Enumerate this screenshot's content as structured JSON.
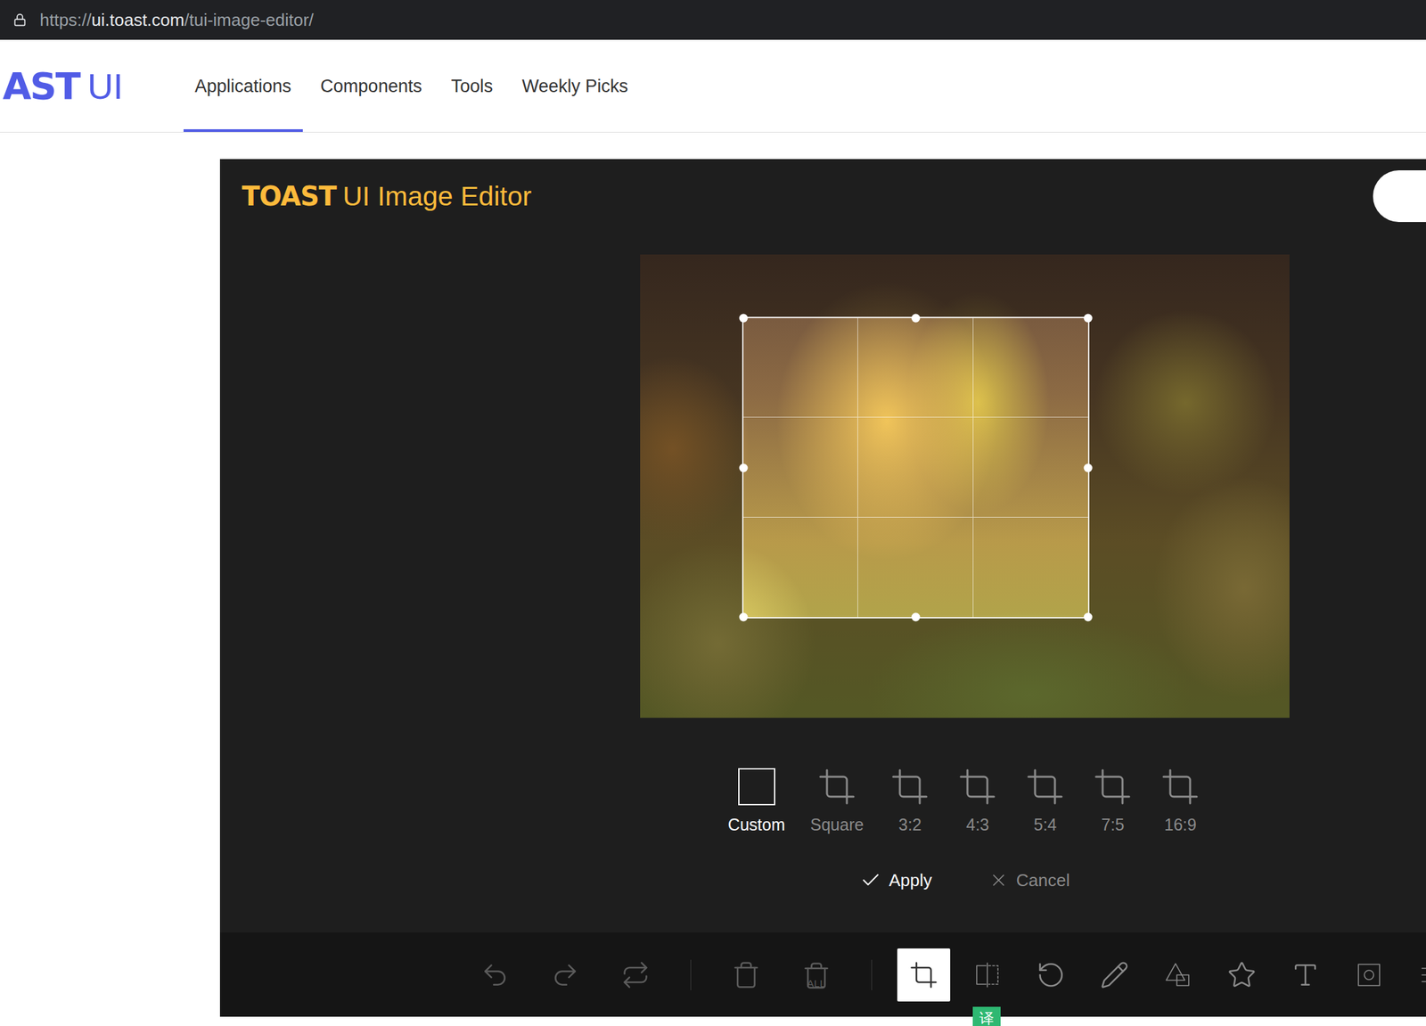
{
  "browser": {
    "scheme": "https://",
    "host": "ui.toast.com",
    "path": "/tui-image-editor/"
  },
  "site": {
    "logo": "AST",
    "logo_suffix": "UI",
    "nav": [
      {
        "label": "Applications",
        "selected": true
      },
      {
        "label": "Components",
        "selected": false
      },
      {
        "label": "Tools",
        "selected": false
      },
      {
        "label": "Weekly Picks",
        "selected": false
      }
    ]
  },
  "editor": {
    "logo": "TOAST",
    "title": "UI Image Editor",
    "crop_presets": [
      {
        "label": "Custom",
        "kind": "custom",
        "selected": true
      },
      {
        "label": "Square",
        "kind": "ratio",
        "selected": false
      },
      {
        "label": "3:2",
        "kind": "ratio",
        "selected": false
      },
      {
        "label": "4:3",
        "kind": "ratio",
        "selected": false
      },
      {
        "label": "5:4",
        "kind": "ratio",
        "selected": false
      },
      {
        "label": "7:5",
        "kind": "ratio",
        "selected": false
      },
      {
        "label": "16:9",
        "kind": "ratio",
        "selected": false
      }
    ],
    "apply": "Apply",
    "cancel": "Cancel",
    "toolbar": [
      {
        "kind": "undo",
        "disabled": true,
        "selected": false
      },
      {
        "kind": "redo",
        "disabled": true,
        "selected": false
      },
      {
        "kind": "reset",
        "disabled": true,
        "selected": false
      },
      {
        "kind": "separator"
      },
      {
        "kind": "delete",
        "disabled": true,
        "selected": false
      },
      {
        "kind": "delete-all",
        "label": "ALL",
        "disabled": true,
        "selected": false
      },
      {
        "kind": "separator"
      },
      {
        "kind": "crop",
        "disabled": false,
        "selected": true
      },
      {
        "kind": "flip",
        "disabled": false,
        "selected": false
      },
      {
        "kind": "rotate",
        "disabled": false,
        "selected": false
      },
      {
        "kind": "draw",
        "disabled": false,
        "selected": false
      },
      {
        "kind": "shape",
        "disabled": false,
        "selected": false
      },
      {
        "kind": "icon",
        "disabled": false,
        "selected": false
      },
      {
        "kind": "text",
        "disabled": false,
        "selected": false
      },
      {
        "kind": "mask",
        "disabled": false,
        "selected": false
      },
      {
        "kind": "filter",
        "disabled": false,
        "selected": false
      }
    ]
  },
  "badge": "译"
}
